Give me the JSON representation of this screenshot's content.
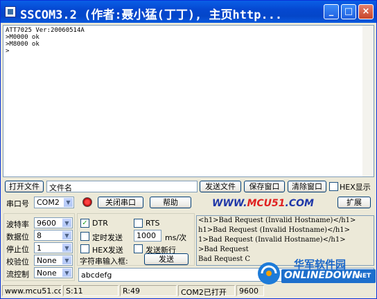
{
  "window": {
    "title": "SSCOM3.2 (作者:聂小猛(丁丁), 主页http...",
    "buttons": {
      "minimize": "_",
      "maximize": "□",
      "close": "×"
    }
  },
  "receive": {
    "lines": "ATT7025 Ver:20060514A\n>M0000 ok\n>M8000 ok\n>"
  },
  "file_row": {
    "open_file": "打开文件",
    "file_name": "文件名",
    "send_file": "发送文件",
    "save_window": "保存窗口",
    "clear_window": "清除窗口",
    "hex_display": "HEX显示"
  },
  "port_row": {
    "port_label": "串口号",
    "port_value": "COM2",
    "close_port": "关闭串口",
    "help": "帮助",
    "site_prefix": "WWW.",
    "site_mid": "MCU51",
    "site_suffix": ".COM",
    "expand": "扩展"
  },
  "settings": {
    "baud_label": "波特率",
    "baud_value": "9600",
    "data_label": "数据位",
    "data_value": "8",
    "stop_label": "停止位",
    "stop_value": "1",
    "parity_label": "校验位",
    "parity_value": "None",
    "flow_label": "流控制",
    "flow_value": "None"
  },
  "options": {
    "dtr": "DTR",
    "rts": "RTS",
    "timed_send": "定时发送",
    "interval": "1000",
    "interval_unit": "ms/次",
    "hex_send": "HEX发送",
    "send_newline": "发送新行",
    "input_label": "字符串输入框:",
    "send": "发送",
    "input_value": "abcdefg"
  },
  "log": [
    "<h1>Bad Request (Invalid Hostname)</h1>",
    "h1>Bad Request (Invalid Hostname)</h1>",
    "1>Bad Request (Invalid Hostname)</h1>",
    ">Bad Request",
    "Bad Request C"
  ],
  "status": {
    "site": "www.mcu51.cor",
    "sent": "S:11",
    "received": "R:49",
    "port_state": "COM2已打开",
    "baud": "9600"
  },
  "watermark": {
    "cn": "华军软件园",
    "en": "ONLINEDOWN",
    "suffix": ".NET"
  },
  "colors": {
    "titlebar": "#0548D1",
    "site_blue": "#1F37A8",
    "site_red": "#E02020"
  }
}
